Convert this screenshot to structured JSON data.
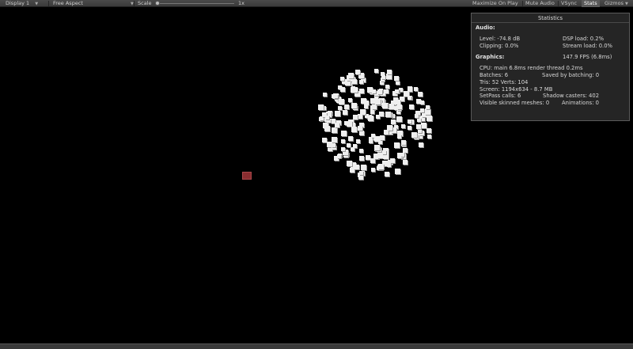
{
  "toolbar": {
    "display": "Display 1",
    "aspect": "Free Aspect",
    "scale_label": "Scale",
    "scale_value": "1x",
    "scale_level": 0.0,
    "maximize": "Maximize On Play",
    "mute": "Mute Audio",
    "vsync": "VSync",
    "stats": "Stats",
    "gizmos": "Gizmos"
  },
  "stats": {
    "title": "Statistics",
    "audio_header": "Audio:",
    "level": "Level: -74.8 dB",
    "dsp": "DSP load: 0.2%",
    "clipping": "Clipping: 0.0%",
    "stream": "Stream load: 0.0%",
    "graphics_header": "Graphics:",
    "fps": "147.9 FPS (6.8ms)",
    "cpu": "CPU: main 6.8ms  render thread 0.2ms",
    "batches": "Batches: 6",
    "saved": "Saved by batching: 0",
    "tris": "Tris: 52   Verts: 104",
    "screen": "Screen: 1194x634 - 8.7 MB",
    "setpass": "SetPass calls: 6",
    "shadow": "Shadow casters: 402",
    "skinned": "Visible skinned meshes: 0",
    "animations": "Animations: 0"
  },
  "colors": {
    "cube": "#efefef",
    "red_cube": "#8a2d30",
    "background": "#000000"
  }
}
